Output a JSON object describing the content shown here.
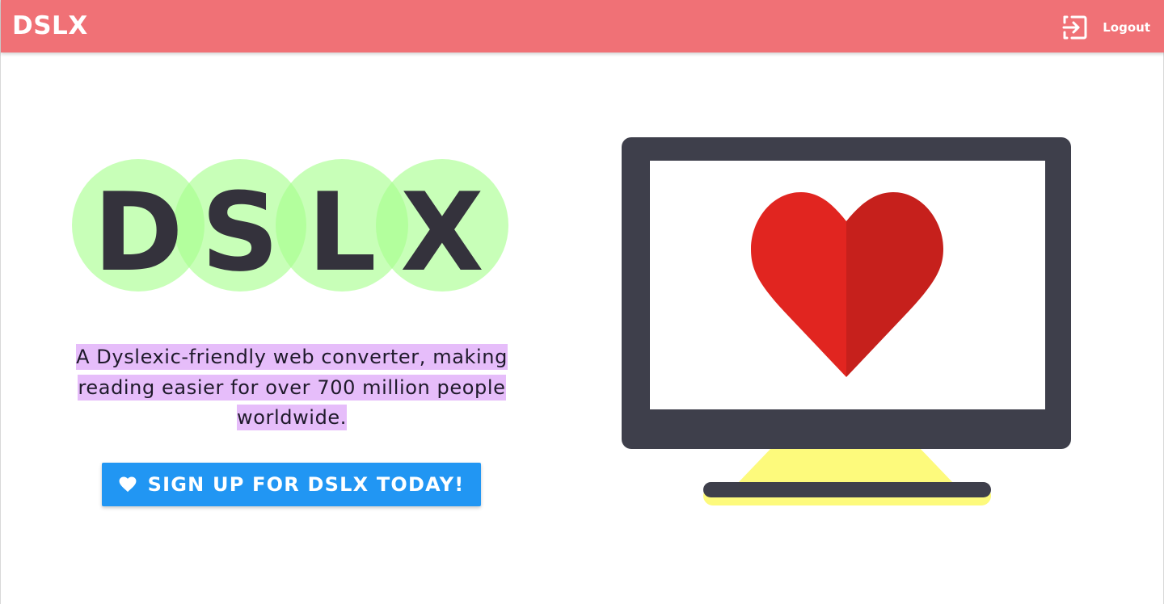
{
  "navbar": {
    "brand": "DSLX",
    "logout_label": "Logout",
    "logout_icon": "logout-icon"
  },
  "hero": {
    "logo_letters": [
      "D",
      "S",
      "L",
      "X"
    ],
    "tagline": "A Dyslexic-friendly web converter, making reading easier for over 700 million people worldwide.",
    "cta_label": "SIGN UP FOR DSLX TODAY!",
    "cta_icon": "heart-icon"
  },
  "colors": {
    "navbar": "#f07176",
    "cta": "#2196f3",
    "tagline_highlight": "#e6bdfa",
    "logo_circle": "#c5fdb8",
    "monitor_frame": "#3e3f4b",
    "heart_left": "#e12520",
    "heart_right": "#c6201c",
    "stand": "#fdfa7c"
  }
}
